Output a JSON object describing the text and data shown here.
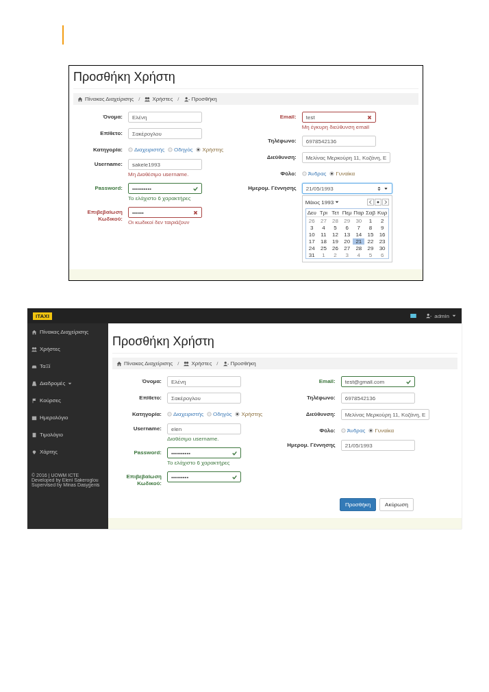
{
  "figures": [
    {
      "kind": "form_only",
      "form": {
        "title": "Προσθήκη Χρήστη",
        "breadcrumb": {
          "separator": "/",
          "items": [
            "Πίνακας Διαχείρισης",
            "Χρήστες",
            "Προσθήκη"
          ]
        },
        "columns": [
          [
            {
              "label": "Όνομα:",
              "kind": "text",
              "value": "Ελένη",
              "error": false,
              "success": false
            },
            {
              "label": "Επίθετο:",
              "kind": "text",
              "value": "Σακέρογλου",
              "error": false,
              "success": false
            },
            {
              "label": "Κατηγορία:",
              "kind": "radio",
              "error": false,
              "success": false,
              "options": [
                {
                  "label": "Διαχειριστής",
                  "selected": false
                },
                {
                  "label": "Οδηγός",
                  "selected": false
                },
                {
                  "label": "Χρήστης",
                  "selected": true
                }
              ]
            },
            {
              "label": "Username:",
              "kind": "text",
              "value": "sakele1993",
              "error": false,
              "success": false,
              "message": {
                "text": "Μη Διαθέσιμο username.",
                "error": true
              }
            },
            {
              "label": "Password:",
              "kind": "text",
              "value": "••••••••••",
              "error": false,
              "success": true,
              "message": {
                "text": "Το ελάχιστο 6 χαρακτήρες",
                "error": false
              }
            },
            {
              "label": "Επιβεβαίωση Κωδικού:",
              "kind": "text",
              "value": "••••••",
              "error": true,
              "success": false,
              "message": {
                "text": "Οι κωδικοί δεν ταιριάζουν",
                "error": true
              }
            }
          ],
          [
            {
              "label": "Email:",
              "kind": "text",
              "value": "test",
              "error": true,
              "success": false,
              "message": {
                "text": "Μη έγκυρη διεύθυνση email",
                "error": true
              }
            },
            {
              "label": "Τηλέφωνο:",
              "kind": "text",
              "value": "6978542136",
              "error": false,
              "success": false
            },
            {
              "label": "Διεύθυνση:",
              "kind": "text",
              "value": "Μελίνας Μερκούρη 11, Κοζάνη, Ε",
              "error": false,
              "success": false
            },
            {
              "label": "Φύλο:",
              "kind": "radio",
              "error": false,
              "success": false,
              "options": [
                {
                  "label": "Άνδρας",
                  "selected": false
                },
                {
                  "label": "Γυναίκα",
                  "selected": true
                }
              ]
            },
            {
              "label": "Ημερομ. Γέννησης",
              "kind": "date",
              "value": "21/05/1993",
              "error": false,
              "success": false,
              "focused": true,
              "calendar": {
                "month_label": "Μάιος 1993",
                "weekdays": [
                  "Δευ",
                  "Τρι",
                  "Τετ",
                  "Πεμ",
                  "Παρ",
                  "Σαβ",
                  "Κυρ"
                ],
                "weeks": [
                  [
                    {
                      "day": "26",
                      "muted": true,
                      "selected": false
                    },
                    {
                      "day": "27",
                      "muted": true,
                      "selected": false
                    },
                    {
                      "day": "28",
                      "muted": true,
                      "selected": false
                    },
                    {
                      "day": "29",
                      "muted": true,
                      "selected": false
                    },
                    {
                      "day": "30",
                      "muted": true,
                      "selected": false
                    },
                    {
                      "day": "1",
                      "muted": false,
                      "selected": false
                    },
                    {
                      "day": "2",
                      "muted": false,
                      "selected": false
                    }
                  ],
                  [
                    {
                      "day": "3",
                      "muted": false,
                      "selected": false
                    },
                    {
                      "day": "4",
                      "muted": false,
                      "selected": false
                    },
                    {
                      "day": "5",
                      "muted": false,
                      "selected": false
                    },
                    {
                      "day": "6",
                      "muted": false,
                      "selected": false
                    },
                    {
                      "day": "7",
                      "muted": false,
                      "selected": false
                    },
                    {
                      "day": "8",
                      "muted": false,
                      "selected": false
                    },
                    {
                      "day": "9",
                      "muted": false,
                      "selected": false
                    }
                  ],
                  [
                    {
                      "day": "10",
                      "muted": false,
                      "selected": false
                    },
                    {
                      "day": "11",
                      "muted": false,
                      "selected": false
                    },
                    {
                      "day": "12",
                      "muted": false,
                      "selected": false
                    },
                    {
                      "day": "13",
                      "muted": false,
                      "selected": false
                    },
                    {
                      "day": "14",
                      "muted": false,
                      "selected": false
                    },
                    {
                      "day": "15",
                      "muted": false,
                      "selected": false
                    },
                    {
                      "day": "16",
                      "muted": false,
                      "selected": false
                    }
                  ],
                  [
                    {
                      "day": "17",
                      "muted": false,
                      "selected": false
                    },
                    {
                      "day": "18",
                      "muted": false,
                      "selected": false
                    },
                    {
                      "day": "19",
                      "muted": false,
                      "selected": false
                    },
                    {
                      "day": "20",
                      "muted": false,
                      "selected": false
                    },
                    {
                      "day": "21",
                      "muted": false,
                      "selected": true
                    },
                    {
                      "day": "22",
                      "muted": false,
                      "selected": false
                    },
                    {
                      "day": "23",
                      "muted": false,
                      "selected": false
                    }
                  ],
                  [
                    {
                      "day": "24",
                      "muted": false,
                      "selected": false
                    },
                    {
                      "day": "25",
                      "muted": false,
                      "selected": false
                    },
                    {
                      "day": "26",
                      "muted": false,
                      "selected": false
                    },
                    {
                      "day": "27",
                      "muted": false,
                      "selected": false
                    },
                    {
                      "day": "28",
                      "muted": false,
                      "selected": false
                    },
                    {
                      "day": "29",
                      "muted": false,
                      "selected": false
                    },
                    {
                      "day": "30",
                      "muted": false,
                      "selected": false
                    }
                  ],
                  [
                    {
                      "day": "31",
                      "muted": false,
                      "selected": false
                    },
                    {
                      "day": "1",
                      "muted": true,
                      "selected": false
                    },
                    {
                      "day": "2",
                      "muted": true,
                      "selected": false
                    },
                    {
                      "day": "3",
                      "muted": true,
                      "selected": false
                    },
                    {
                      "day": "4",
                      "muted": true,
                      "selected": false
                    },
                    {
                      "day": "5",
                      "muted": true,
                      "selected": false
                    },
                    {
                      "day": "6",
                      "muted": true,
                      "selected": false
                    }
                  ]
                ]
              }
            }
          ]
        ]
      }
    },
    {
      "kind": "app",
      "navbar": {
        "logo": "iTAXI",
        "user": "admin"
      },
      "sidebar": {
        "items": [
          {
            "label": "Πίνακας Διαχείρισης",
            "has_caret": false
          },
          {
            "label": "Χρήστες",
            "has_caret": false
          },
          {
            "label": "ΤαΞί",
            "has_caret": false
          },
          {
            "label": "Διαδρομές",
            "has_caret": true
          },
          {
            "label": "Κούρσες",
            "has_caret": false
          },
          {
            "label": "Ημερολόγιο",
            "has_caret": false
          },
          {
            "label": "Τιμολόγιο",
            "has_caret": false
          },
          {
            "label": "Χάρτης",
            "has_caret": false
          }
        ],
        "footer": [
          "© 2016 | UOWM ICTE",
          "Developed by Eleni Sakeroglou",
          "Supervised by Minas Dasygenis"
        ]
      },
      "form": {
        "title": "Προσθήκη Χρήστη",
        "breadcrumb": {
          "separator": "/",
          "items": [
            "Πίνακας Διαχείρισης",
            "Χρήστες",
            "Προσθήκη"
          ]
        },
        "columns": [
          [
            {
              "label": "Όνομα:",
              "kind": "text",
              "value": "Ελένη",
              "error": false,
              "success": false
            },
            {
              "label": "Επίθετο:",
              "kind": "text",
              "value": "Σακέρογλου",
              "error": false,
              "success": false
            },
            {
              "label": "Κατηγορία:",
              "kind": "radio",
              "error": false,
              "success": false,
              "options": [
                {
                  "label": "Διαχειριστής",
                  "selected": false
                },
                {
                  "label": "Οδηγός",
                  "selected": false
                },
                {
                  "label": "Χρήστης",
                  "selected": true
                }
              ]
            },
            {
              "label": "Username:",
              "kind": "text",
              "value": "elen",
              "error": false,
              "success": false,
              "message": {
                "text": "Διαθέσιμο username.",
                "error": false
              }
            },
            {
              "label": "Password:",
              "kind": "text",
              "value": "••••••••••",
              "error": false,
              "success": true,
              "message": {
                "text": "Το ελάχιστο 6 χαρακτήρες",
                "error": false
              }
            },
            {
              "label": "Επιβεβαίωση Κωδικού:",
              "kind": "text",
              "value": "•••••••••",
              "error": false,
              "success": true
            }
          ],
          [
            {
              "label": "Email:",
              "kind": "text",
              "value": "test@gmail.com",
              "error": false,
              "success": true
            },
            {
              "label": "Τηλέφωνο:",
              "kind": "text",
              "value": "6978542136",
              "error": false,
              "success": false
            },
            {
              "label": "Διεύθυνση:",
              "kind": "text",
              "value": "Μελίνας Μερκούρη 11, Κοζάνη, Ε",
              "error": false,
              "success": false
            },
            {
              "label": "Φύλο:",
              "kind": "radio",
              "error": false,
              "success": false,
              "options": [
                {
                  "label": "Άνδρας",
                  "selected": false
                },
                {
                  "label": "Γυναίκα",
                  "selected": true
                }
              ]
            },
            {
              "label": "Ημερομ. Γέννησης",
              "kind": "date",
              "value": "21/05/1993",
              "error": false,
              "success": false,
              "focused": false
            }
          ]
        ],
        "buttons": [
          {
            "label": "Προσθήκη",
            "kind": "primary"
          },
          {
            "label": "Ακύρωση",
            "kind": "default"
          }
        ]
      }
    }
  ]
}
